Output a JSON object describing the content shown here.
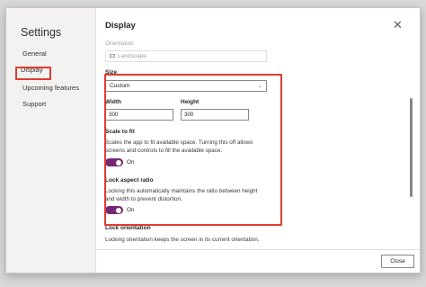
{
  "nav": {
    "title": "Settings",
    "items": [
      {
        "label": "General"
      },
      {
        "label": "Display"
      },
      {
        "label": "Upcoming features"
      },
      {
        "label": "Support"
      }
    ]
  },
  "content": {
    "title": "Display",
    "close_icon": "close-icon",
    "orientation": {
      "label": "Orientation",
      "value": "Landscape"
    },
    "size": {
      "label": "Size",
      "value": "Custom"
    },
    "width": {
      "label": "Width",
      "value": "300"
    },
    "height": {
      "label": "Height",
      "value": "300"
    },
    "scale_to_fit": {
      "label": "Scale to fit",
      "description": "Scales the app to fit available space. Turning this off allows screens and controls to fill the available space.",
      "state": "On"
    },
    "lock_aspect": {
      "label": "Lock aspect ratio",
      "description": "Locking this automatically maintains the ratio between height and width to prevent distortion.",
      "state": "On"
    },
    "lock_orientation": {
      "label": "Lock orientation",
      "description": "Locking orientation keeps the screen in its current orientation."
    }
  },
  "footer": {
    "close_label": "Close"
  },
  "colors": {
    "accent": "#742774",
    "highlight": "#e03c31"
  }
}
